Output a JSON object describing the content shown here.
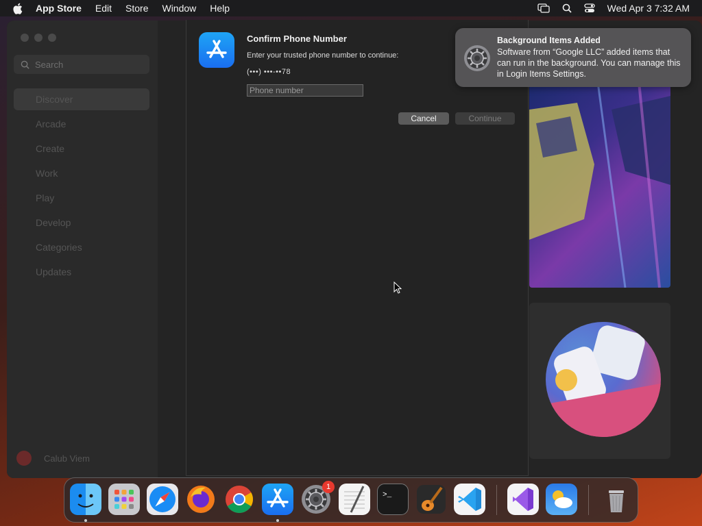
{
  "menubar": {
    "app_name": "App Store",
    "menus": [
      "Edit",
      "Store",
      "Window",
      "Help"
    ],
    "datetime": "Wed Apr 3  7:32 AM",
    "status_icons": [
      "screen-mirroring-icon",
      "search-icon",
      "control-center-icon"
    ]
  },
  "sidebar": {
    "search_placeholder": "Search",
    "items": [
      {
        "label": "Discover",
        "active": true
      },
      {
        "label": "Arcade"
      },
      {
        "label": "Create"
      },
      {
        "label": "Work"
      },
      {
        "label": "Play"
      },
      {
        "label": "Develop"
      },
      {
        "label": "Categories"
      },
      {
        "label": "Updates"
      }
    ],
    "user_name": "Calub Viem"
  },
  "sheet": {
    "title": "Confirm Phone Number",
    "message": "Enter your trusted phone number to continue:",
    "masked_phone": "(•••) •••-••78",
    "phone_placeholder": "Phone number",
    "phone_value": "",
    "cancel_label": "Cancel",
    "continue_label": "Continue"
  },
  "notification": {
    "title": "Background Items Added",
    "body": "Software from “Google LLC” added items that can run in the background. You can manage this in Login Items Settings."
  },
  "dock": {
    "apps": [
      "Finder",
      "Launchpad",
      "Safari",
      "Firefox",
      "Google Chrome",
      "App Store",
      "System Settings",
      "TextEdit",
      "Terminal",
      "GarageBand",
      "Visual Studio Code",
      "Visual Studio",
      "Weather",
      "Trash"
    ],
    "system_settings_badge": "1"
  },
  "colors": {
    "accent": "#1a84f5",
    "badge": "#e8392e"
  }
}
